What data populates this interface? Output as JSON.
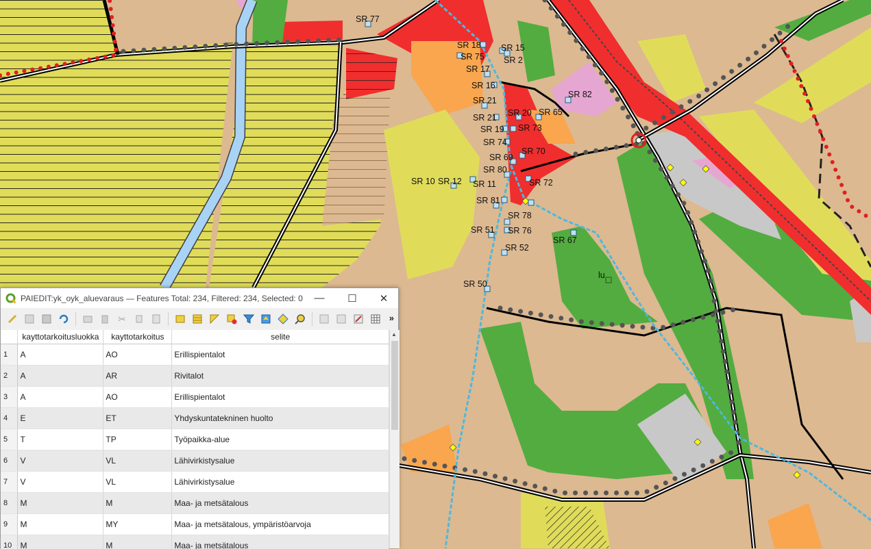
{
  "map": {
    "labels": {
      "sr77": "SR 77",
      "sr18": "SR 18",
      "sr15": "SR 15",
      "sr75": "SR 75",
      "sr2": "SR 2",
      "sr17": "SR 17",
      "sr16": "SR 16",
      "sr82": "SR 82",
      "sr21": "SR 21",
      "sr20": "SR 20",
      "sr65": "SR 65",
      "sr22": "SR 21",
      "sr73": "SR 73",
      "sr19": "SR 19",
      "sr74": "SR 74",
      "sr70": "SR 70",
      "sr69": "SR 69",
      "sr80": "SR 80",
      "sr10": "SR 10",
      "sr12": "SR 12",
      "sr11": "SR 11",
      "sr72": "SR 72",
      "sr81": "SR 81",
      "sr78": "SR 78",
      "sr51": "SR 51",
      "sr76": "SR 76",
      "sr67": "SR 67",
      "sr52": "SR 52",
      "sr50": "SR 50",
      "lu": "lu"
    },
    "colors": {
      "background": "#dcb991",
      "residential": "#e0dc5a",
      "center": "#f02e2e",
      "orange": "#f9a64e",
      "green": "#53ac40",
      "grey": "#c8c8c8",
      "pink": "#e6a6d2",
      "river": "#a9d3f5",
      "road": "#000000"
    }
  },
  "attribute_table": {
    "title": "PAIEDIT:yk_oyk_aluevaraus — Features Total: 234, Filtered: 234, Selected: 0",
    "window_controls": {
      "minimize": "—",
      "maximize": "☐",
      "close": "✕"
    },
    "toolbar_more": "»",
    "columns": [
      "kayttotarkoitusluokka",
      "kayttotarkoitus",
      "selite"
    ],
    "rows": [
      {
        "n": "1",
        "luokka": "A",
        "tarkoitus": "AO",
        "selite": "Erillispientalot"
      },
      {
        "n": "2",
        "luokka": "A",
        "tarkoitus": "AR",
        "selite": "Rivitalot"
      },
      {
        "n": "3",
        "luokka": "A",
        "tarkoitus": "AO",
        "selite": "Erillispientalot"
      },
      {
        "n": "4",
        "luokka": "E",
        "tarkoitus": "ET",
        "selite": "Yhdyskuntatekninen huolto"
      },
      {
        "n": "5",
        "luokka": "T",
        "tarkoitus": "TP",
        "selite": "Työpaikka-alue"
      },
      {
        "n": "6",
        "luokka": "V",
        "tarkoitus": "VL",
        "selite": "Lähivirkistysalue"
      },
      {
        "n": "7",
        "luokka": "V",
        "tarkoitus": "VL",
        "selite": "Lähivirkistysalue"
      },
      {
        "n": "8",
        "luokka": "M",
        "tarkoitus": "M",
        "selite": "Maa- ja metsätalous"
      },
      {
        "n": "9",
        "luokka": "M",
        "tarkoitus": "MY",
        "selite": "Maa- ja metsätalous, ympäristöarvoja"
      },
      {
        "n": "10",
        "luokka": "M",
        "tarkoitus": "M",
        "selite": "Maa- ja metsätalous"
      }
    ]
  }
}
